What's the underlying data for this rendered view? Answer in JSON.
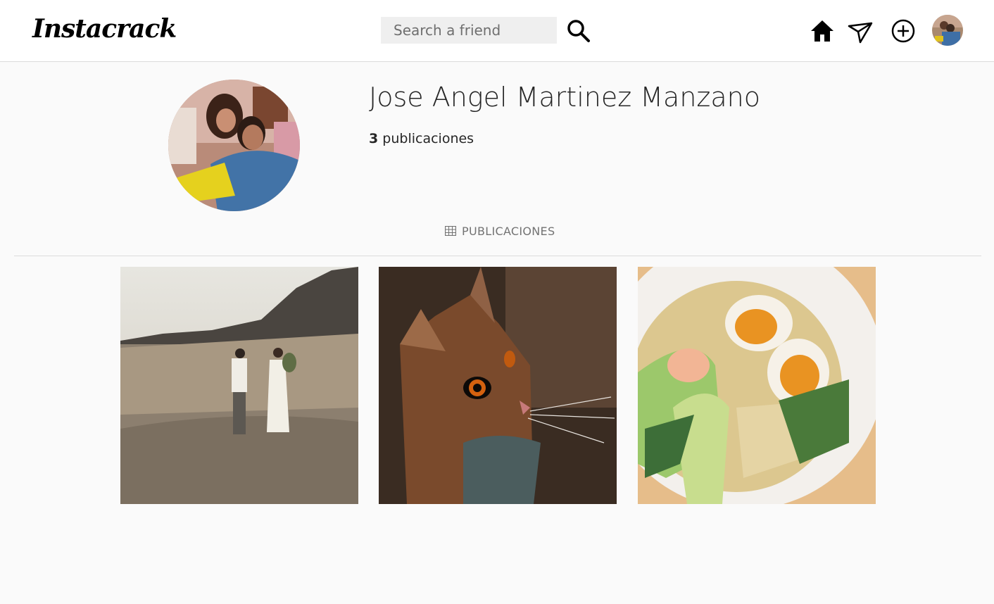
{
  "header": {
    "logo": "Instacrack",
    "search": {
      "placeholder": "Search a friend",
      "value": ""
    },
    "icons": [
      "search-icon",
      "home-icon",
      "send-icon",
      "add-circle-icon",
      "avatar"
    ]
  },
  "profile": {
    "name": "Jose Angel Martinez Manzano",
    "posts_count": "3",
    "posts_label": "publicaciones"
  },
  "tabs": [
    {
      "label": "PUBLICACIONES",
      "icon": "grid-icon",
      "active": true
    }
  ],
  "posts": [
    {
      "subject": "couple walking in a field"
    },
    {
      "subject": "orange tabby cat"
    },
    {
      "subject": "ramen bowl with eggs"
    }
  ],
  "colors": {
    "background": "#fafafa",
    "topbar": "#ffffff",
    "border": "#dbdbdb",
    "search_bg": "#efefef",
    "muted_text": "#737373"
  }
}
